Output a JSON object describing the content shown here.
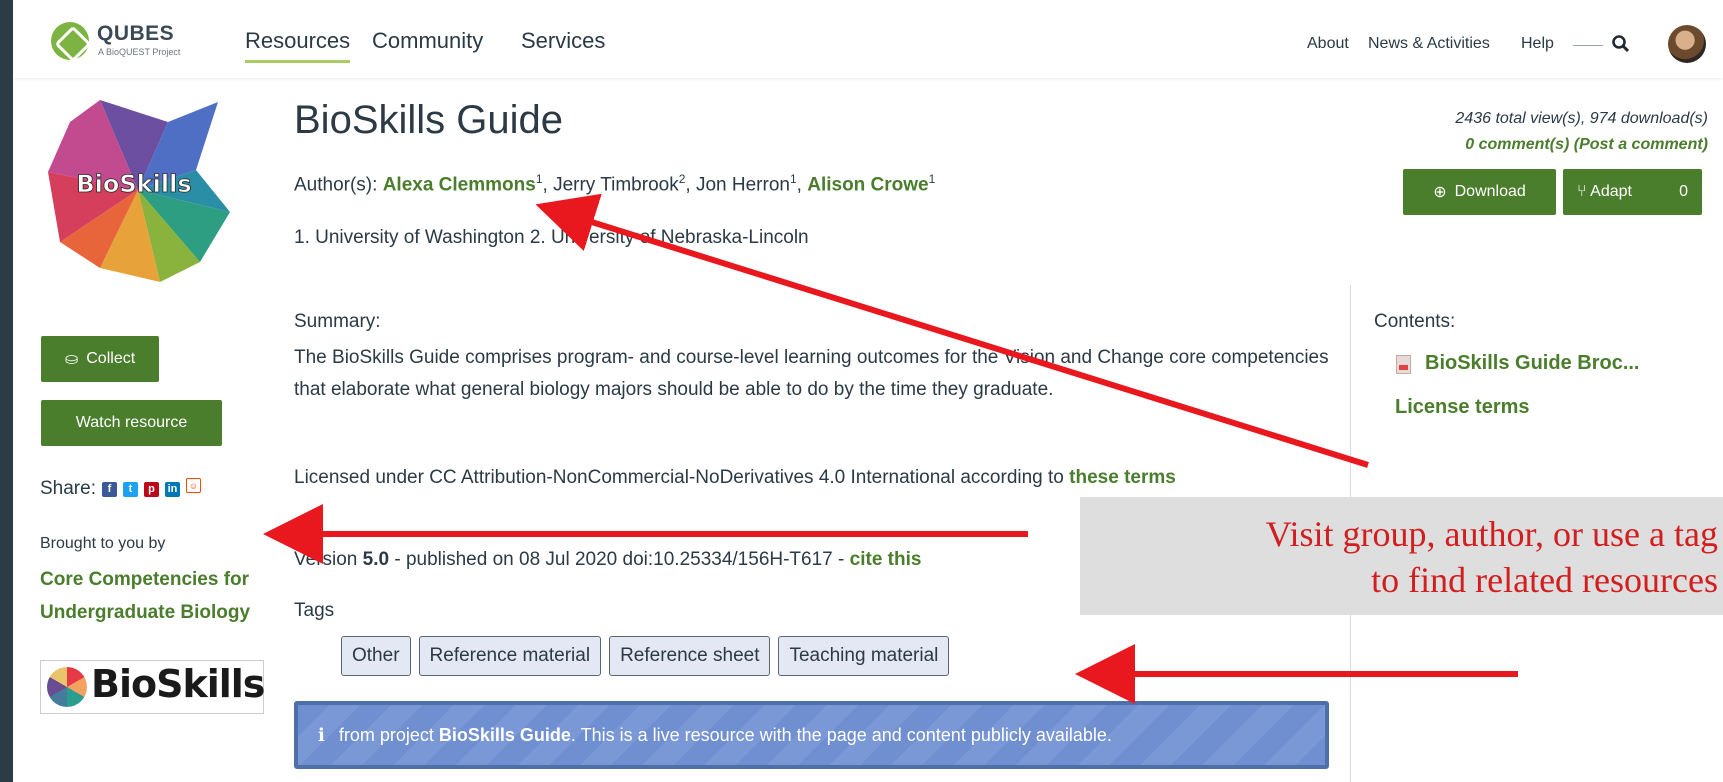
{
  "header": {
    "logo_title": "QUBES",
    "logo_subtitle": "A BioQUEST Project",
    "nav_main": [
      "Resources",
      "Community",
      "Services"
    ],
    "nav_secondary": [
      "About",
      "News & Activities",
      "Help"
    ]
  },
  "sidebar": {
    "logo_alt": "BioSkills",
    "collect_label": "Collect",
    "watch_label": "Watch resource",
    "share_label": "Share:",
    "brought_label": "Brought to you by",
    "group_name": "Core Competencies for Undergraduate Biology",
    "group_logo_text": "BioSkills"
  },
  "resource": {
    "title": "BioSkills Guide",
    "authors_label": "Author(s):",
    "authors": [
      {
        "name": "Alexa Clemmons",
        "sup": "1",
        "linked": true
      },
      {
        "name": "Jerry Timbrook",
        "sup": "2",
        "linked": false
      },
      {
        "name": "Jon Herron",
        "sup": "1",
        "linked": false
      },
      {
        "name": "Alison Crowe",
        "sup": "1",
        "linked": true
      }
    ],
    "affiliations": "1. University of Washington 2. University of Nebraska-Lincoln",
    "summary_label": "Summary:",
    "summary": "The BioSkills Guide comprises program- and course-level learning outcomes for the Vision and Change core competencies that elaborate what general biology majors should be able to do by the time they graduate.",
    "license_text": "Licensed under CC Attribution-NonCommercial-NoDerivatives 4.0 International according to",
    "license_link": "these terms",
    "version_label": "Version",
    "version": "5.0",
    "published": "- published on 08 Jul 2020 doi:10.25334/156H-T617 -",
    "cite_label": "cite this",
    "tags_label": "Tags",
    "tags": [
      "Other",
      "Reference material",
      "Reference sheet",
      "Teaching material"
    ],
    "info_prefix": "from project",
    "info_project": "BioSkills Guide",
    "info_suffix": ". This is a live resource with the page and content publicly available."
  },
  "stats": {
    "views_downloads": "2436 total view(s), 974 download(s)",
    "comments": "0 comment(s)",
    "post_comment": "(Post a comment)",
    "download_label": "Download",
    "adapt_label": "Adapt",
    "adapt_count": "0"
  },
  "contents": {
    "label": "Contents:",
    "file": "BioSkills Guide Broc...",
    "license_terms": "License terms"
  },
  "annotation": {
    "line1": "Visit group, author, or use a tag",
    "line2": "to find related resources",
    "color": "#d21e1e"
  },
  "colors": {
    "accent_green": "#4a7d2c",
    "nav_underline": "#aacd63",
    "info_blue": "#7a98d6"
  }
}
